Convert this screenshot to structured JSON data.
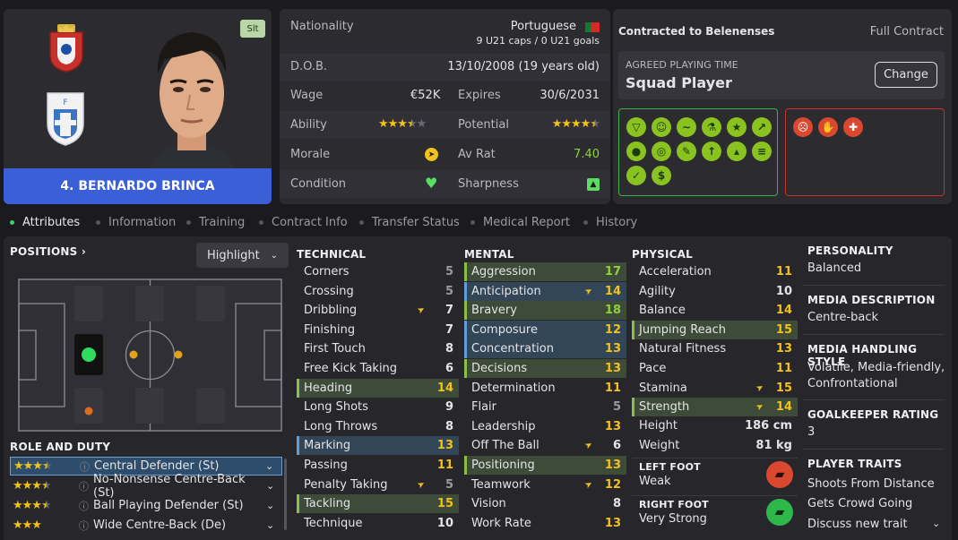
{
  "player": {
    "name": "4. BERNARDO BRINCA",
    "badge": "Slt"
  },
  "info": {
    "nationality_label": "Nationality",
    "nationality": "Portuguese",
    "caps": "9 U21 caps / 0 U21 goals",
    "dob_label": "D.O.B.",
    "dob": "13/10/2008 (19 years old)",
    "wage_label": "Wage",
    "wage": "€52K",
    "expires_label": "Expires",
    "expires": "30/6/2031",
    "ability_label": "Ability",
    "ability_stars": 3.5,
    "potential_label": "Potential",
    "potential_stars": 4.5,
    "morale_label": "Morale",
    "avrat_label": "Av Rat",
    "avrat": "7.40",
    "condition_label": "Condition",
    "sharpness_label": "Sharpness"
  },
  "contract": {
    "title": "Contracted to Belenenses",
    "type": "Full Contract",
    "playing_time_label": "AGREED PLAYING TIME",
    "playing_time": "Squad Player",
    "change_label": "Change"
  },
  "tabs": [
    "Attributes",
    "Information",
    "Training",
    "Contract Info",
    "Transfer Status",
    "Medical Report",
    "History"
  ],
  "positions": {
    "title": "POSITIONS",
    "highlight_label": "Highlight"
  },
  "role_duty": {
    "title": "ROLE AND DUTY",
    "roles": [
      {
        "label": "Central Defender (St)",
        "stars": 3.5
      },
      {
        "label": "No-Nonsense Centre-Back (St)",
        "stars": 3.5
      },
      {
        "label": "Ball Playing Defender (St)",
        "stars": 3.5
      },
      {
        "label": "Wide Centre-Back (De)",
        "stars": 3
      }
    ]
  },
  "technical": {
    "title": "TECHNICAL",
    "attrs": [
      {
        "name": "Corners",
        "value": "5",
        "cls": "v-low",
        "hl": ""
      },
      {
        "name": "Crossing",
        "value": "5",
        "cls": "v-low",
        "hl": ""
      },
      {
        "name": "Dribbling",
        "value": "7",
        "cls": "v-mid",
        "hl": "",
        "arrow": true
      },
      {
        "name": "Finishing",
        "value": "7",
        "cls": "v-mid",
        "hl": ""
      },
      {
        "name": "First Touch",
        "value": "8",
        "cls": "v-mid",
        "hl": ""
      },
      {
        "name": "Free Kick Taking",
        "value": "6",
        "cls": "v-mid",
        "hl": ""
      },
      {
        "name": "Heading",
        "value": "14",
        "cls": "v-good",
        "hl": "hl-green"
      },
      {
        "name": "Long Shots",
        "value": "9",
        "cls": "v-mid",
        "hl": ""
      },
      {
        "name": "Long Throws",
        "value": "8",
        "cls": "v-mid",
        "hl": ""
      },
      {
        "name": "Marking",
        "value": "13",
        "cls": "v-good",
        "hl": "hl-blue"
      },
      {
        "name": "Passing",
        "value": "11",
        "cls": "v-good",
        "hl": ""
      },
      {
        "name": "Penalty Taking",
        "value": "5",
        "cls": "v-low",
        "hl": "",
        "arrow": true
      },
      {
        "name": "Tackling",
        "value": "15",
        "cls": "v-good",
        "hl": "hl-green"
      },
      {
        "name": "Technique",
        "value": "10",
        "cls": "v-mid",
        "hl": ""
      }
    ]
  },
  "mental": {
    "title": "MENTAL",
    "attrs": [
      {
        "name": "Aggression",
        "value": "17",
        "cls": "v-great",
        "hl": "hl-green"
      },
      {
        "name": "Anticipation",
        "value": "14",
        "cls": "v-good",
        "hl": "hl-blue",
        "arrow": true
      },
      {
        "name": "Bravery",
        "value": "18",
        "cls": "v-great",
        "hl": "hl-green"
      },
      {
        "name": "Composure",
        "value": "12",
        "cls": "v-good",
        "hl": "hl-blue"
      },
      {
        "name": "Concentration",
        "value": "13",
        "cls": "v-good",
        "hl": "hl-blue"
      },
      {
        "name": "Decisions",
        "value": "13",
        "cls": "v-good",
        "hl": "hl-green"
      },
      {
        "name": "Determination",
        "value": "11",
        "cls": "v-good",
        "hl": ""
      },
      {
        "name": "Flair",
        "value": "5",
        "cls": "v-low",
        "hl": ""
      },
      {
        "name": "Leadership",
        "value": "13",
        "cls": "v-good",
        "hl": ""
      },
      {
        "name": "Off The Ball",
        "value": "6",
        "cls": "v-mid",
        "hl": "",
        "arrow": true
      },
      {
        "name": "Positioning",
        "value": "13",
        "cls": "v-good",
        "hl": "hl-green"
      },
      {
        "name": "Teamwork",
        "value": "12",
        "cls": "v-good",
        "hl": "",
        "arrow": true
      },
      {
        "name": "Vision",
        "value": "8",
        "cls": "v-mid",
        "hl": ""
      },
      {
        "name": "Work Rate",
        "value": "13",
        "cls": "v-good",
        "hl": ""
      }
    ]
  },
  "physical": {
    "title": "PHYSICAL",
    "attrs": [
      {
        "name": "Acceleration",
        "value": "11",
        "cls": "v-good",
        "hl": ""
      },
      {
        "name": "Agility",
        "value": "10",
        "cls": "v-mid",
        "hl": ""
      },
      {
        "name": "Balance",
        "value": "14",
        "cls": "v-good",
        "hl": ""
      },
      {
        "name": "Jumping Reach",
        "value": "15",
        "cls": "v-good",
        "hl": "hl-green"
      },
      {
        "name": "Natural Fitness",
        "value": "13",
        "cls": "v-good",
        "hl": ""
      },
      {
        "name": "Pace",
        "value": "11",
        "cls": "v-good",
        "hl": ""
      },
      {
        "name": "Stamina",
        "value": "15",
        "cls": "v-good",
        "hl": "",
        "arrow": true
      },
      {
        "name": "Strength",
        "value": "14",
        "cls": "v-good",
        "hl": "hl-green",
        "arrow": true
      }
    ],
    "height_label": "Height",
    "height": "186 cm",
    "weight_label": "Weight",
    "weight": "81 kg",
    "left_foot_label": "LEFT FOOT",
    "left_foot": "Weak",
    "right_foot_label": "RIGHT FOOT",
    "right_foot": "Very Strong"
  },
  "side": {
    "personality_label": "PERSONALITY",
    "personality": "Balanced",
    "media_desc_label": "MEDIA DESCRIPTION",
    "media_desc": "Centre-back",
    "media_style_label": "MEDIA HANDLING STYLE",
    "media_style": "Volatile, Media-friendly, Confrontational",
    "gk_label": "GOALKEEPER RATING",
    "gk": "3",
    "traits_label": "PLAYER TRAITS",
    "traits": [
      "Shoots From Distance",
      "Gets Crowd Going",
      "Discuss new trait"
    ]
  },
  "colors": {
    "accent": "#3b5fd6",
    "good": "#8ac21f",
    "bad": "#d9482f"
  }
}
